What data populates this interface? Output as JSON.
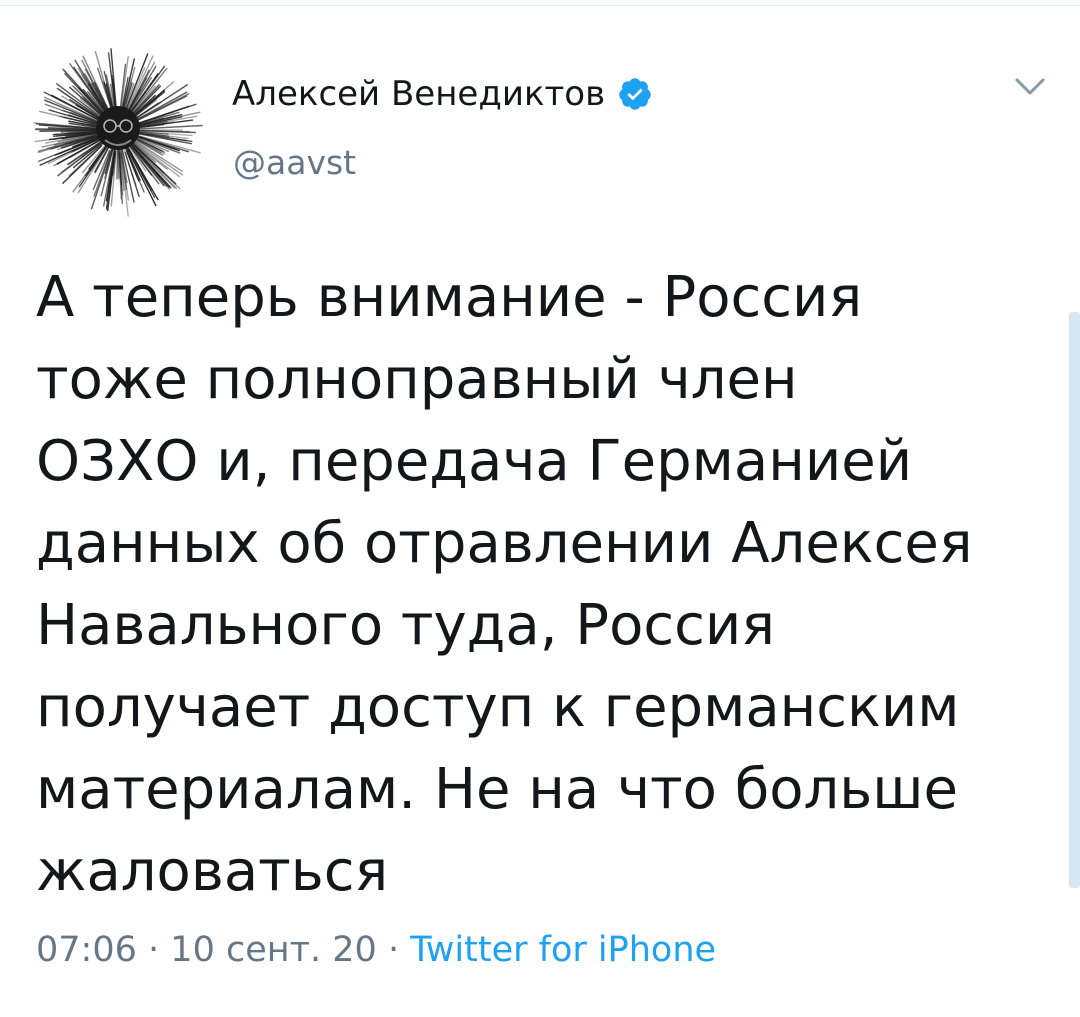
{
  "tweet": {
    "author": {
      "display_name": "Алексей Венедиктов",
      "handle": "@aavst",
      "verified": true,
      "avatar_icon": "avatar-icon"
    },
    "text": "А теперь внимание - Россия\nтоже полноправный член\nОЗХО и, передача Германией\nданных об отравлении Алексея\nНавального туда, Россия\nполучает доступ к германским\nматериалам. Не на что больше\nжаловаться",
    "time": "07:06",
    "separator": "·",
    "date": "10 сент. 20",
    "source": "Twitter for iPhone"
  },
  "icons": {
    "verified": "verified-badge-icon",
    "menu": "chevron-down-icon"
  },
  "colors": {
    "text": "#14171a",
    "muted": "#657786",
    "accent": "#1da1f2",
    "divider": "#e6ecf0"
  }
}
